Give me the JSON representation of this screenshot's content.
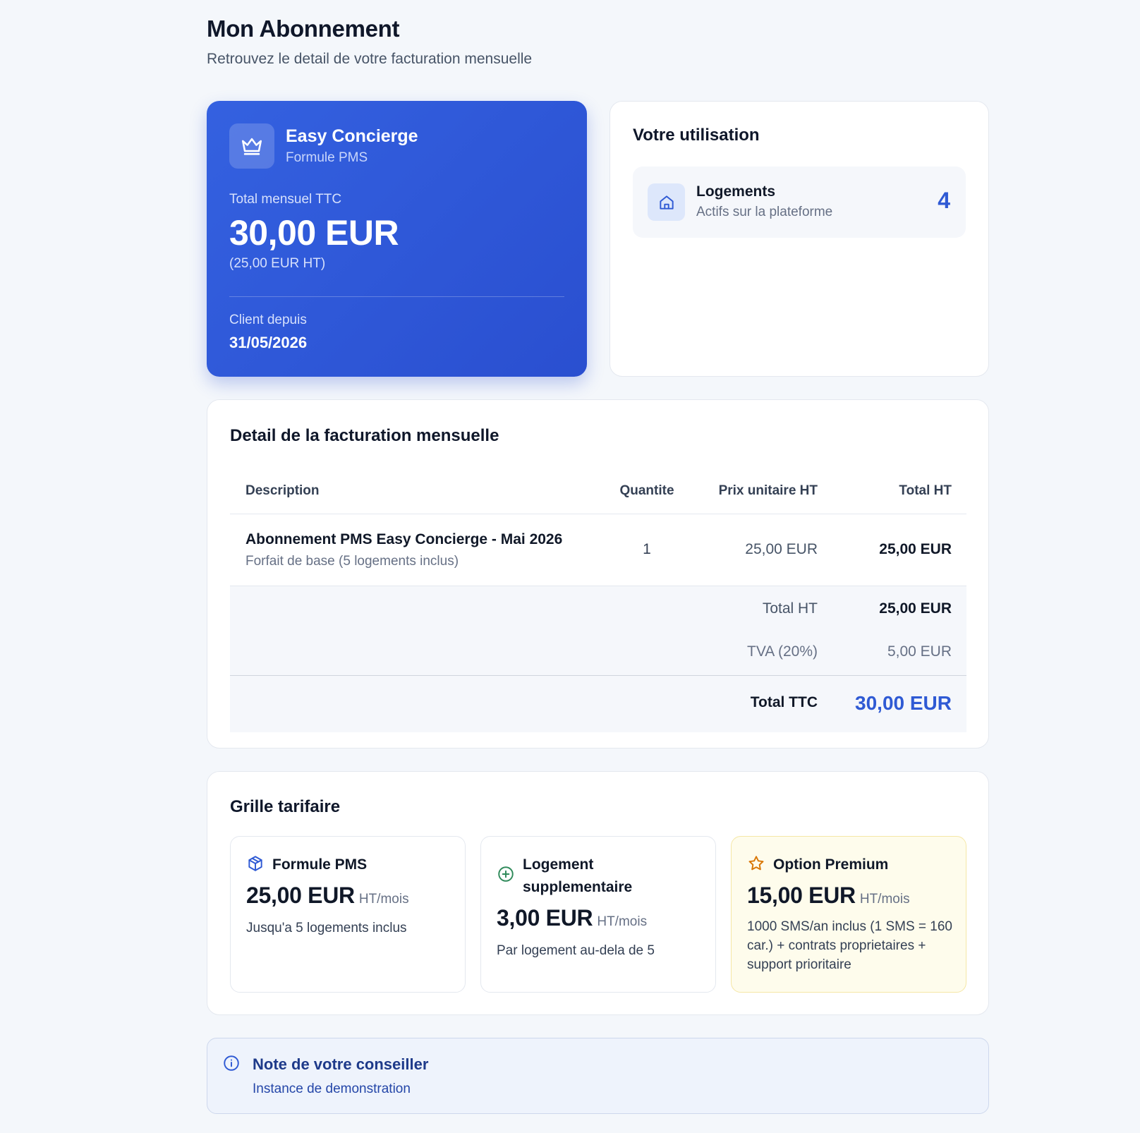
{
  "header": {
    "title": "Mon Abonnement",
    "subtitle": "Retrouvez le detail de votre facturation mensuelle"
  },
  "plan": {
    "icon": "crown-icon",
    "name": "Easy Concierge",
    "formula": "Formule PMS",
    "total_label": "Total mensuel TTC",
    "total": "30,00 EUR",
    "total_ht": "(25,00 EUR HT)",
    "since_label": "Client depuis",
    "since": "31/05/2026"
  },
  "usage": {
    "title": "Votre utilisation",
    "items": [
      {
        "icon": "home-icon",
        "label": "Logements",
        "sub": "Actifs sur la plateforme",
        "count": "4"
      }
    ]
  },
  "billing": {
    "title": "Detail de la facturation mensuelle",
    "columns": [
      "Description",
      "Quantite",
      "Prix unitaire HT",
      "Total HT"
    ],
    "rows": [
      {
        "title": "Abonnement PMS Easy Concierge - Mai 2026",
        "sub": "Forfait de base (5 logements inclus)",
        "qty": "1",
        "unit": "25,00 EUR",
        "total": "25,00 EUR"
      }
    ],
    "summary": {
      "total_ht_label": "Total HT",
      "total_ht": "25,00 EUR",
      "tva_label": "TVA (20%)",
      "tva": "5,00 EUR",
      "total_ttc_label": "Total TTC",
      "total_ttc": "30,00 EUR"
    }
  },
  "pricing": {
    "title": "Grille tarifaire",
    "tiers": [
      {
        "icon": "package-icon",
        "name": "Formule PMS",
        "price": "25,00 EUR",
        "unit": "HT/mois",
        "desc": "Jusqu'a 5 logements inclus"
      },
      {
        "icon": "plus-circle-icon",
        "name": "Logement supplementaire",
        "price": "3,00 EUR",
        "unit": "HT/mois",
        "desc": "Par logement au-dela de 5"
      },
      {
        "icon": "star-icon",
        "name": "Option Premium",
        "price": "15,00 EUR",
        "unit": "HT/mois",
        "desc": "1000 SMS/an inclus (1 SMS = 160 car.) + contrats proprietaires + support prioritaire"
      }
    ]
  },
  "note": {
    "icon": "info-icon",
    "title": "Note de votre conseiller",
    "text": "Instance de demonstration"
  },
  "colors": {
    "accent": "#2f5ad4",
    "plan_gradient_start": "#3461e0",
    "plan_gradient_end": "#2a4fd0",
    "premium_bg": "#fefcec",
    "note_bg": "#eef3fc"
  }
}
